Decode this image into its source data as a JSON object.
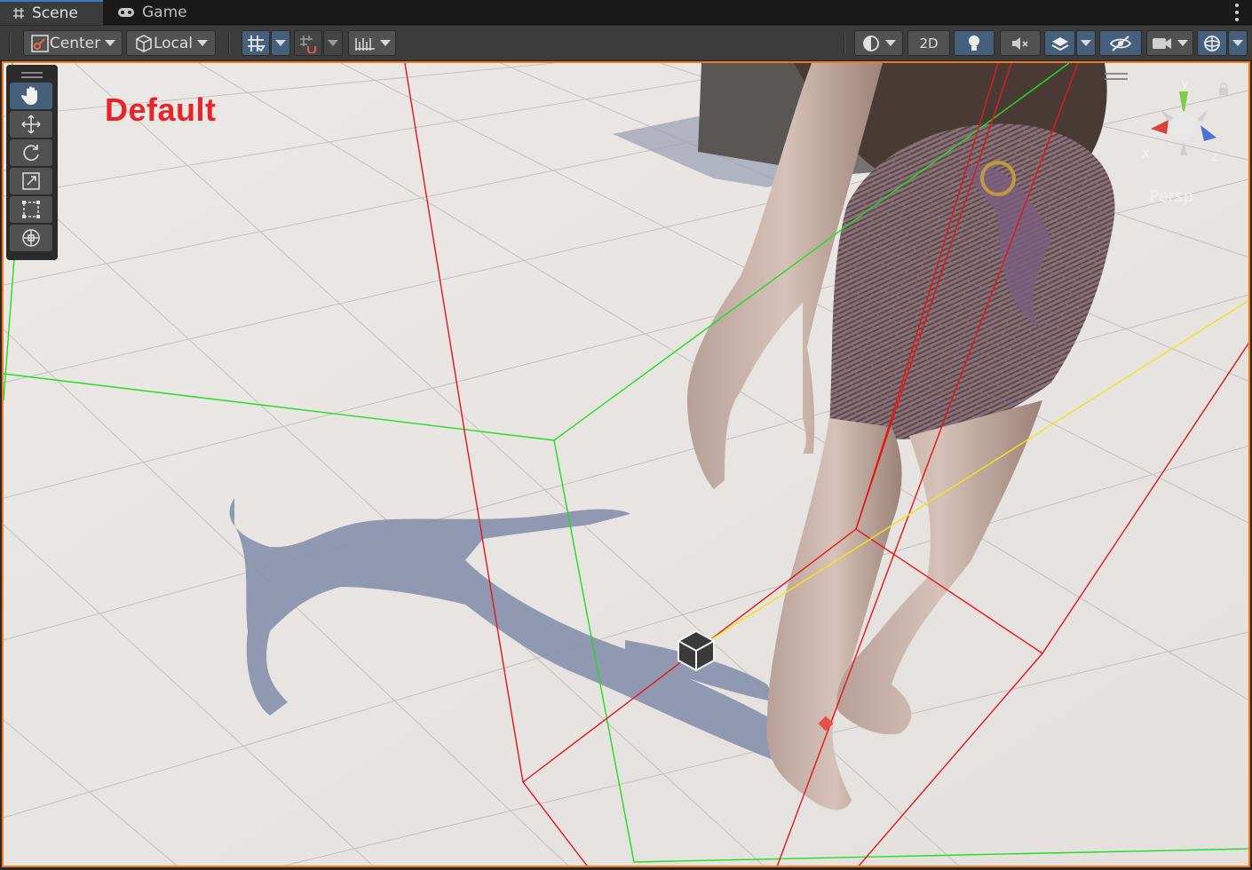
{
  "tabs": [
    {
      "label": "Scene",
      "icon": "grid-hash-icon",
      "active": true
    },
    {
      "label": "Game",
      "icon": "gamepad-icon",
      "active": false
    }
  ],
  "toolbar": {
    "pivot_label": "Center",
    "handle_label": "Local",
    "mode_2d_label": "2D"
  },
  "viewport": {
    "overlay_label": "Default",
    "projection_label": "Persp",
    "gizmo_axes": {
      "x": "x",
      "y": "y",
      "z": "z"
    }
  },
  "colors": {
    "selection_outline": "#f07a1e",
    "accent_blue": "#46607c",
    "label_red": "#e8232a"
  }
}
